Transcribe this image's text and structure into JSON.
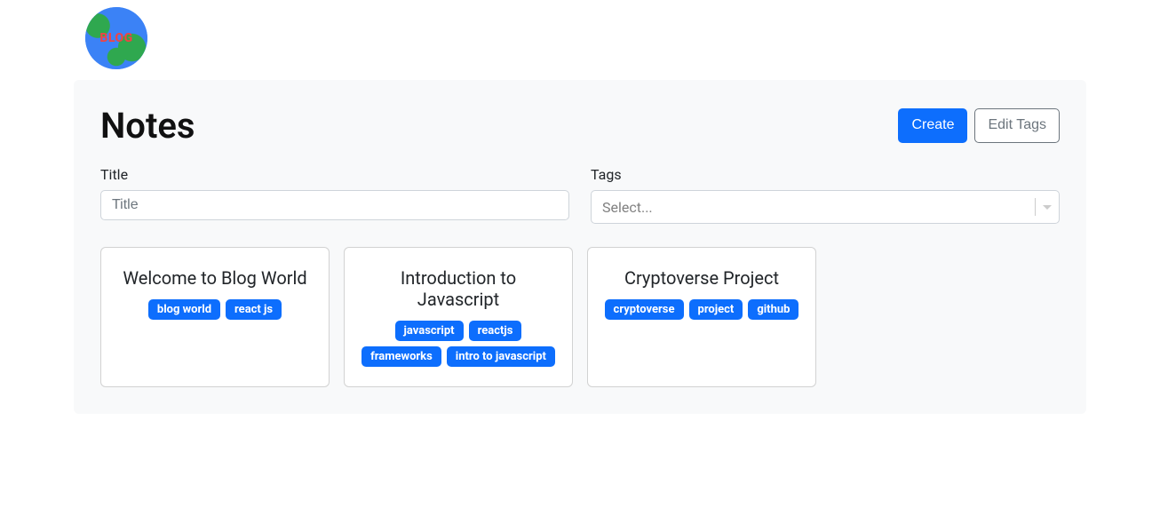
{
  "logo": {
    "text": "BLOG"
  },
  "header": {
    "title": "Notes",
    "create_label": "Create",
    "edit_tags_label": "Edit Tags"
  },
  "filters": {
    "title_label": "Title",
    "title_placeholder": "Title",
    "tags_label": "Tags",
    "tags_placeholder": "Select..."
  },
  "notes": [
    {
      "title": "Welcome to Blog World",
      "tags": [
        "blog world",
        "react js"
      ]
    },
    {
      "title": "Introduction to Javascript",
      "tags": [
        "javascript",
        "reactjs",
        "frameworks",
        "intro to javascript"
      ]
    },
    {
      "title": "Cryptoverse Project",
      "tags": [
        "cryptoverse",
        "project",
        "github"
      ]
    }
  ]
}
